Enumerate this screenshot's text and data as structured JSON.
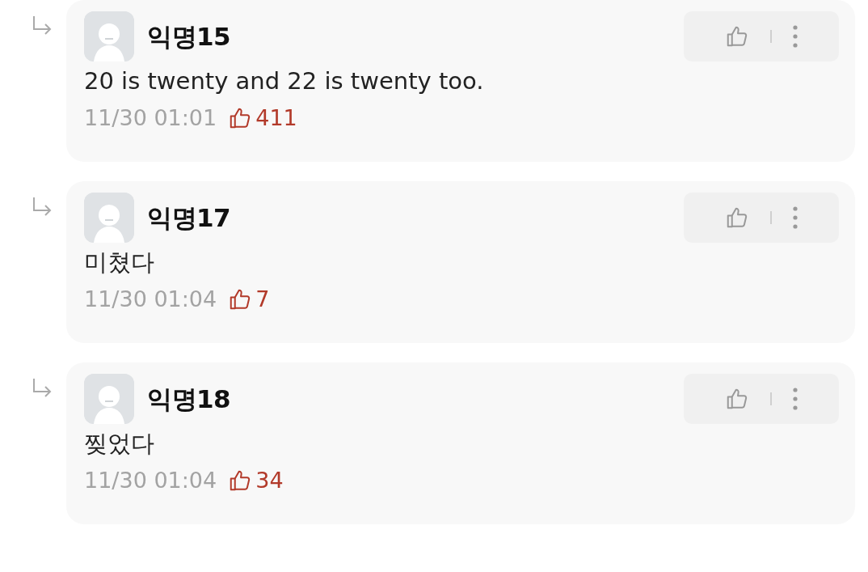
{
  "comments": [
    {
      "author": "익명15",
      "text": "20 is twenty and 22 is twenty too.",
      "time": "11/30 01:01",
      "likes": "411"
    },
    {
      "author": "익명17",
      "text": "미쳤다",
      "time": "11/30 01:04",
      "likes": "7"
    },
    {
      "author": "익명18",
      "text": "찢었다",
      "time": "11/30 01:04",
      "likes": "34"
    }
  ]
}
